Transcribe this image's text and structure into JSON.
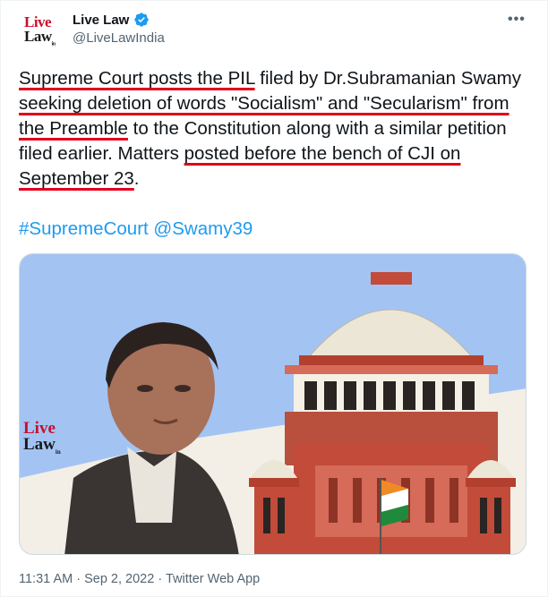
{
  "account": {
    "display_name": "Live Law",
    "handle": "@LiveLawIndia",
    "avatar_line1": "Live",
    "avatar_line2": "Law",
    "avatar_sub": "in",
    "verified_icon": "verified-badge-icon",
    "verified_color": "#1d9bf0"
  },
  "more_icon": "more-horizontal-icon",
  "tweet": {
    "segments": [
      "Supreme Court posts the PIL",
      " filed by Dr.Subramanian Swamy ",
      "seeking deletion of words \"Socialism\" and \"Secularism\" from the Preamble",
      " to the Constitution along with a similar petition filed earlier. Matters ",
      "posted before the bench of CJI on September 23",
      "."
    ],
    "underline_color": "#e0001b",
    "hashtag": "#SupremeCourt",
    "mention": "@Swamy39",
    "link_color": "#1d9bf0"
  },
  "media": {
    "logo_line1": "Live",
    "logo_line2": "Law",
    "logo_sub": "in",
    "background_color": "#a3c4f3"
  },
  "footer": {
    "time": "11:31 AM",
    "date": "Sep 2, 2022",
    "app": "Twitter Web App",
    "separator": " · "
  }
}
